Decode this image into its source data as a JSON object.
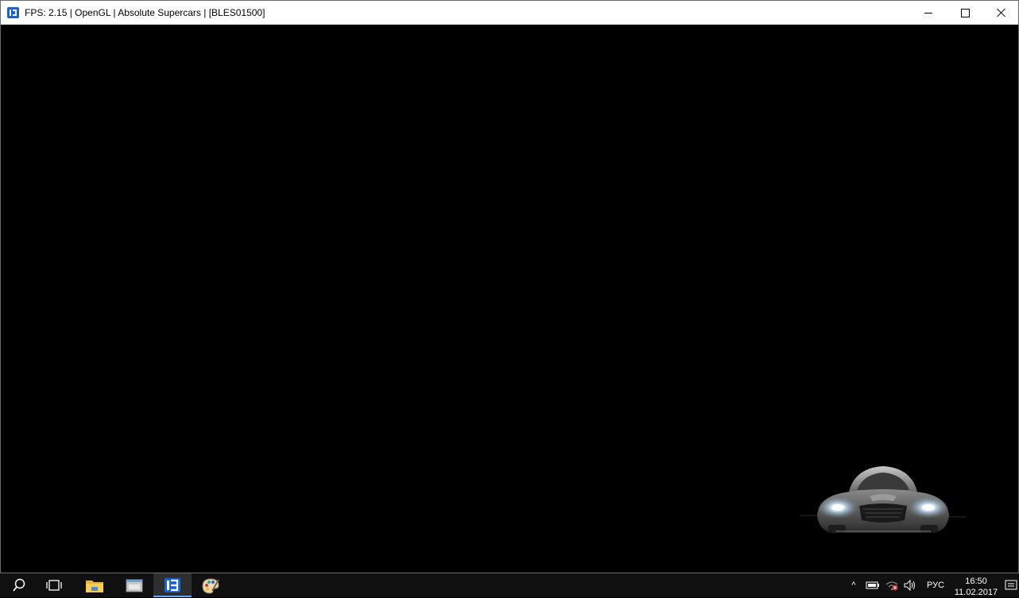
{
  "window": {
    "title": "FPS: 2.15 | OpenGL | Absolute Supercars | [BLES01500]"
  },
  "taskbar": {
    "apps": [
      {
        "name": "file-explorer",
        "icon": "folder-icon"
      },
      {
        "name": "app",
        "icon": "window-app-icon"
      },
      {
        "name": "rpcs3",
        "icon": "rpcs3-icon",
        "active": true
      },
      {
        "name": "paint",
        "icon": "palette-icon"
      }
    ]
  },
  "tray": {
    "chevron": "^",
    "language": "РУС",
    "time": "16:50",
    "date": "11.02.2017"
  },
  "colors": {
    "titlebar_bg": "#ffffff",
    "game_bg": "#000000",
    "taskbar_bg": "#101010",
    "accent": "#1a63d6",
    "active_indicator": "#6aa8ff"
  }
}
